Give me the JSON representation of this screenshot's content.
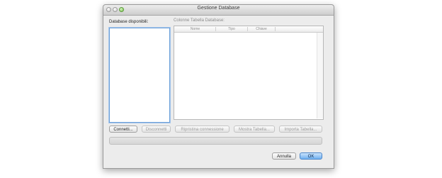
{
  "window": {
    "title": "Gestione Database"
  },
  "left_panel": {
    "label": "Database disponibili:"
  },
  "right_panel": {
    "label": "Colonne Tabella Database:",
    "columns": [
      "Nome",
      "Tipo",
      "Chiave"
    ]
  },
  "buttons": {
    "connect": "Connetti...",
    "disconnect": "Disconnetti",
    "restore": "Ripristina connessione",
    "show_table": "Mostra Tabella...",
    "import_table": "Importa Tabella..."
  },
  "footer": {
    "cancel": "Annulla",
    "ok": "OK"
  },
  "colors": {
    "accent": "#6fb0f0",
    "focus_ring": "#6b9fd8"
  }
}
